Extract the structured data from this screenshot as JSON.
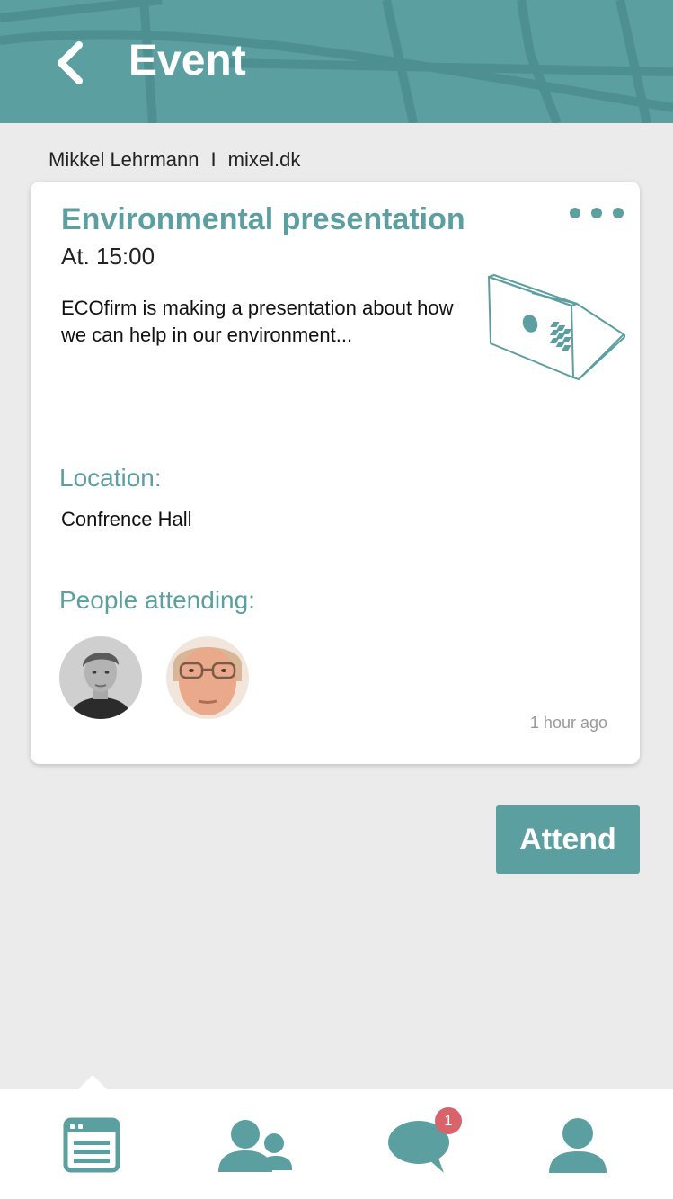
{
  "header": {
    "title": "Event",
    "back_icon": "chevron-left-icon",
    "background_color": "#5c9fa1"
  },
  "organizer": {
    "name": "Mikkel Lehrmann",
    "separator": "I",
    "website": "mixel.dk"
  },
  "event": {
    "title": "Environmental presentation",
    "time": "At. 15:00",
    "description": "ECOfirm is making a presentation about how we can help in our environment...",
    "illustration_icon": "laptop-icon",
    "location_label": "Location:",
    "location": "Confrence Hall",
    "attending_label": "People attending:",
    "attendees": [
      {
        "avatar": "attendee-photo-1"
      },
      {
        "avatar": "attendee-photo-2"
      }
    ],
    "posted": "1 hour ago",
    "more_icon": "more-dots-icon"
  },
  "actions": {
    "attend_label": "Attend"
  },
  "tab_bar": {
    "tabs": [
      {
        "icon": "events-icon",
        "active": true
      },
      {
        "icon": "people-icon",
        "active": false
      },
      {
        "icon": "messages-icon",
        "active": false,
        "badge": "1"
      },
      {
        "icon": "profile-icon",
        "active": false
      }
    ]
  },
  "colors": {
    "accent": "#5c9fa1",
    "background": "#ebebeb",
    "badge": "#d9636a",
    "secondary_text": "#9a9a9a"
  }
}
